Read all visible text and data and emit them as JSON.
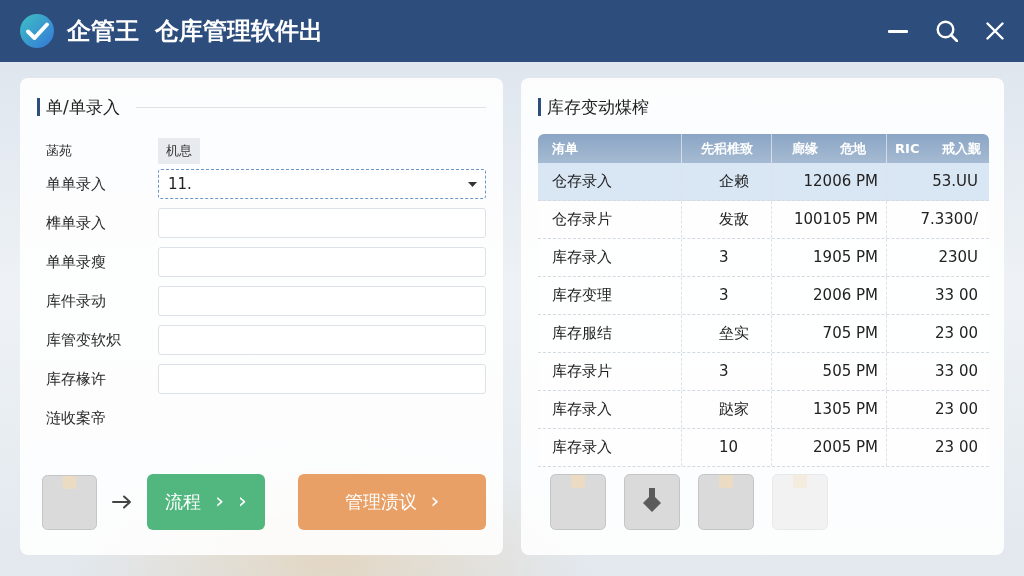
{
  "window": {
    "app_name": "企管王",
    "title": "仓库管理软件出",
    "controls": [
      {
        "kind": "minimize"
      },
      {
        "kind": "search"
      },
      {
        "kind": "close"
      }
    ]
  },
  "entry_panel": {
    "title": "单/单录入",
    "header": {
      "column_1": "菡苑",
      "column_2": "机息"
    },
    "fields": [
      {
        "label": "单单录入",
        "kind": "select",
        "value": "11.",
        "focused": true
      },
      {
        "label": "榫单录入",
        "kind": "text",
        "focused": false
      },
      {
        "label": "单单录瘦",
        "kind": "text",
        "focused": false
      },
      {
        "label": "库件录动",
        "kind": "text",
        "focused": false
      },
      {
        "label": "库管变软炽",
        "kind": "text",
        "focused": false
      },
      {
        "label": "库存椽许",
        "kind": "text",
        "focused": false
      },
      {
        "label": "涟收案帝",
        "kind": "label"
      }
    ],
    "actions": [
      {
        "kind": "tile"
      },
      {
        "kind": "arrow"
      },
      {
        "kind": "button",
        "label": "流程",
        "color": "#52b77e",
        "trailing_marks": [
          "›",
          "›"
        ]
      },
      {
        "kind": "button",
        "label": "管理渍议",
        "color": "#e9a066",
        "trailing_marks": [
          "›"
        ]
      }
    ]
  },
  "stock_panel": {
    "title": "库存变动煤榨",
    "table": {
      "columns": [
        "洧单",
        "先稆椎致",
        "廊缘 危地",
        "RIC 戒入觐"
      ],
      "rows": [
        {
          "cells": [
            "仓存录入",
            "企赖",
            "12006 PM",
            "53.UU"
          ],
          "selected": true
        },
        {
          "cells": [
            "仓存录片",
            "发敌",
            "100105 PM",
            "7.3300/"
          ],
          "selected": false
        },
        {
          "cells": [
            "库存录入",
            "3",
            "1905 PM",
            "230U"
          ],
          "selected": false
        },
        {
          "cells": [
            "库存变理",
            "3",
            "2006 PM",
            "33 00"
          ],
          "selected": false
        },
        {
          "cells": [
            "库存服结",
            "垒实",
            "705 PM",
            "23 00"
          ],
          "selected": false
        },
        {
          "cells": [
            "库存录片",
            "3",
            "505 PM",
            "33 00"
          ],
          "selected": false
        },
        {
          "cells": [
            "库存录入",
            "跶家",
            "1305 PM",
            "23 00"
          ],
          "selected": false
        },
        {
          "cells": [
            "库存录入",
            "10",
            "2005 PM",
            "23 00"
          ],
          "selected": false
        }
      ]
    },
    "tool_tiles": [
      {
        "kind": "box",
        "disabled": false
      },
      {
        "kind": "box-arrow",
        "disabled": false
      },
      {
        "kind": "box",
        "disabled": false
      },
      {
        "kind": "box",
        "disabled": true
      }
    ]
  }
}
